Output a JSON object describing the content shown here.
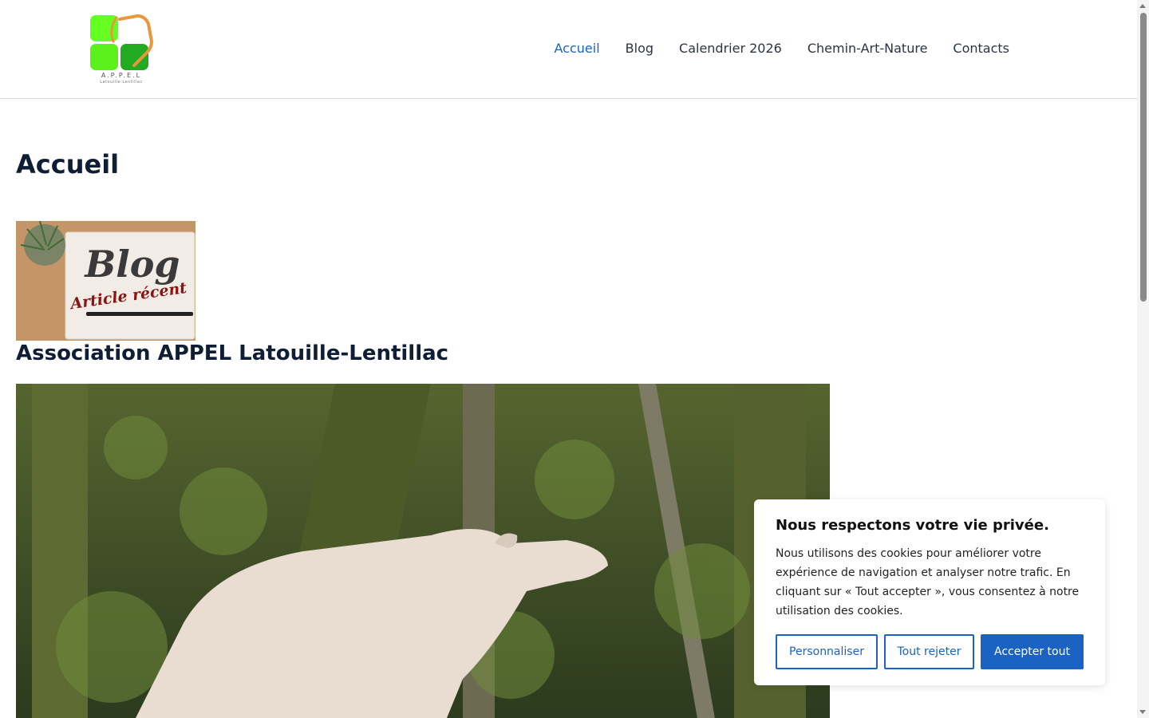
{
  "header": {
    "logo": {
      "alt_text": "A.P.P.E.L",
      "subtext": "Latouille-Lentillac",
      "colors": {
        "light_green": "#66ff22",
        "dark_green": "#22aa22",
        "orange": "#e8973a"
      }
    },
    "nav": [
      {
        "label": "Accueil",
        "active": true
      },
      {
        "label": "Blog",
        "active": false
      },
      {
        "label": "Calendrier 2026",
        "active": false
      },
      {
        "label": "Chemin-Art-Nature",
        "active": false
      },
      {
        "label": "Contacts",
        "active": false
      }
    ]
  },
  "main": {
    "title": "Accueil",
    "blog_thumbnail": {
      "text_main": "Blog",
      "text_sub": "Article récent"
    },
    "subtitle": "Association APPEL Latouille-Lentillac"
  },
  "cookie_banner": {
    "title": "Nous respectons votre vie privée.",
    "body": "Nous utilisons des cookies pour améliorer votre expérience de navigation et analyser notre trafic. En cliquant sur « Tout accepter », vous consentez à notre utilisation des cookies.",
    "buttons": {
      "customize": "Personnaliser",
      "reject": "Tout rejeter",
      "accept": "Accepter tout"
    }
  },
  "colors": {
    "accent": "#1a63c2",
    "heading": "#0f1e35",
    "nav_text": "#2b3442"
  }
}
